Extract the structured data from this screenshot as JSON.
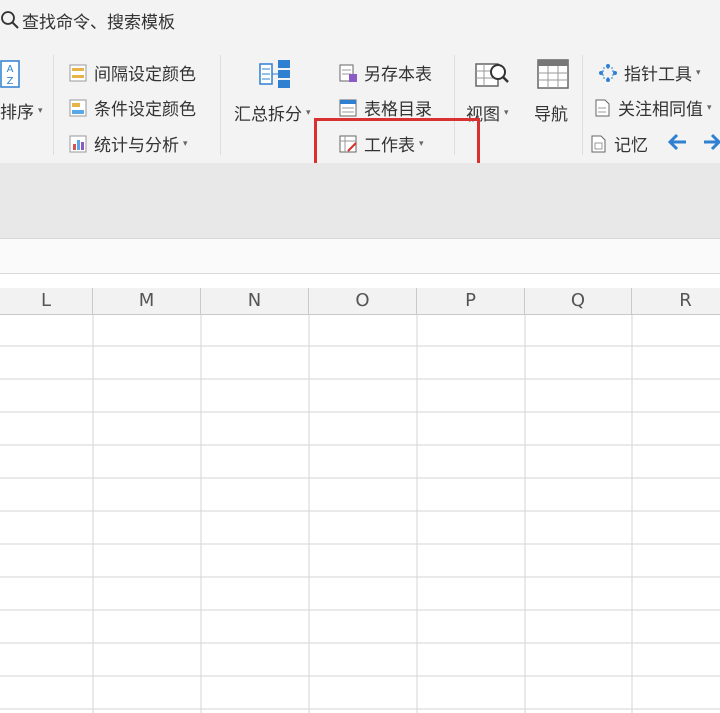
{
  "search": {
    "placeholder": "查找命令、搜索模板",
    "icon": "search-icon"
  },
  "ribbon": {
    "sort": {
      "label": "排序",
      "icon": "sort-az-icon"
    },
    "interval_color": {
      "label": "间隔设定颜色",
      "icon": "interval-color-icon"
    },
    "condition_color": {
      "label": "条件设定颜色",
      "icon": "condition-color-icon"
    },
    "stats": {
      "label": "统计与分析",
      "icon": "stats-analysis-icon"
    },
    "summary_split": {
      "label": "汇总拆分",
      "icon": "summary-split-icon"
    },
    "save_sheet": {
      "label": "另存本表",
      "icon": "save-sheet-icon"
    },
    "table_toc": {
      "label": "表格目录",
      "icon": "table-toc-icon"
    },
    "worksheet": {
      "label": "工作表",
      "icon": "worksheet-icon"
    },
    "view": {
      "label": "视图",
      "icon": "view-magnifier-icon"
    },
    "nav": {
      "label": "导航",
      "icon": "navigation-grid-icon"
    },
    "pointer_tool": {
      "label": "指针工具",
      "icon": "pointer-tool-icon"
    },
    "focus_same": {
      "label": "关注相同值",
      "icon": "focus-same-value-icon"
    },
    "memory": {
      "label": "记忆",
      "icon": "memory-icon"
    },
    "arrow_left": {
      "icon": "arrow-left-icon"
    },
    "arrow_right": {
      "icon": "arrow-right-icon"
    }
  },
  "columns": [
    "L",
    "M",
    "N",
    "O",
    "P",
    "Q",
    "R"
  ],
  "colors": {
    "accent_blue": "#2f80d1",
    "highlight": "#d9312f"
  }
}
